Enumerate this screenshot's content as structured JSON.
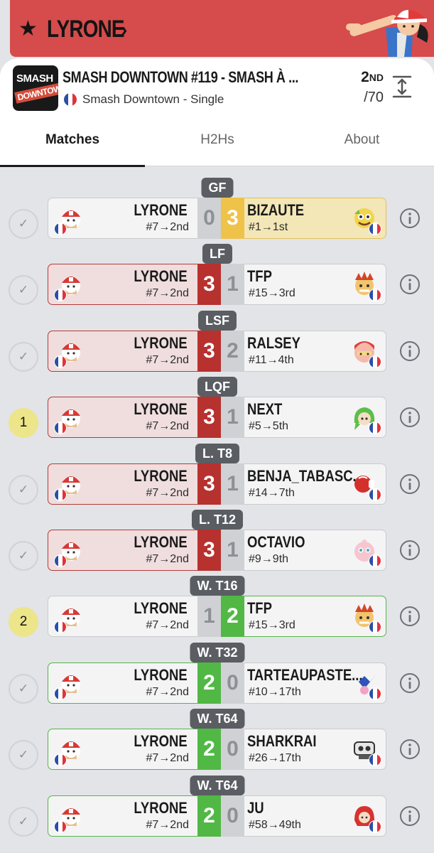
{
  "player": {
    "name": "LYRONE",
    "star_icon": "star-icon",
    "chevron_icon": "chevron-right-icon"
  },
  "tournament": {
    "logo_top": "SMASH",
    "logo_bottom": "DOWNTOWN",
    "title": "SMASH DOWNTOWN #119 - SMASH À ...",
    "subtitle": "Smash Downtown - Single",
    "placement": "2",
    "placement_suffix": "ND",
    "total": "/70"
  },
  "tabs": [
    {
      "label": "Matches",
      "active": true
    },
    {
      "label": "H2Hs",
      "active": false
    },
    {
      "label": "About",
      "active": false
    }
  ],
  "colors": {
    "loss_red": "#b7312f",
    "win_green": "#51b845",
    "gf_gold": "#efc24a",
    "banner_red": "#d64b4b"
  },
  "matches": [
    {
      "round": "GF",
      "check": "✓",
      "left_name": "LYRONE",
      "left_seed": "#7→2nd",
      "left_score": "0",
      "right_score": "3",
      "right_name": "BIZAUTE",
      "right_seed": "#1→1st",
      "result": "gf",
      "opp_icon": "character-icon"
    },
    {
      "round": "LF",
      "check": "✓",
      "left_name": "LYRONE",
      "left_seed": "#7→2nd",
      "left_score": "3",
      "right_score": "1",
      "right_name": "TFP",
      "right_seed": "#15→3rd",
      "result": "lose",
      "opp_icon": "character-icon"
    },
    {
      "round": "LSF",
      "check": "✓",
      "left_name": "LYRONE",
      "left_seed": "#7→2nd",
      "left_score": "3",
      "right_score": "2",
      "right_name": "RALSEY",
      "right_seed": "#11→4th",
      "result": "lose",
      "opp_icon": "character-icon"
    },
    {
      "round": "LQF",
      "check": "1",
      "left_name": "LYRONE",
      "left_seed": "#7→2nd",
      "left_score": "3",
      "right_score": "1",
      "right_name": "NEXT",
      "right_seed": "#5→5th",
      "result": "lose",
      "opp_icon": "character-icon"
    },
    {
      "round": "L. T8",
      "check": "✓",
      "left_name": "LYRONE",
      "left_seed": "#7→2nd",
      "left_score": "3",
      "right_score": "1",
      "right_name": "BENJA_TABASC...",
      "right_seed": "#14→7th",
      "result": "lose",
      "opp_icon": "character-icon"
    },
    {
      "round": "L. T12",
      "check": "✓",
      "left_name": "LYRONE",
      "left_seed": "#7→2nd",
      "left_score": "3",
      "right_score": "1",
      "right_name": "OCTAVIO",
      "right_seed": "#9→9th",
      "result": "lose",
      "opp_icon": "character-icon"
    },
    {
      "round": "W. T16",
      "check": "2",
      "left_name": "LYRONE",
      "left_seed": "#7→2nd",
      "left_score": "1",
      "right_score": "2",
      "right_name": "TFP",
      "right_seed": "#15→3rd",
      "result": "win_r",
      "opp_icon": "character-icon"
    },
    {
      "round": "W. T32",
      "check": "✓",
      "left_name": "LYRONE",
      "left_seed": "#7→2nd",
      "left_score": "2",
      "right_score": "0",
      "right_name": "TARTEAUPASTE...",
      "right_seed": "#10→17th",
      "result": "win",
      "opp_icon": "character-icon"
    },
    {
      "round": "W. T64",
      "check": "✓",
      "left_name": "LYRONE",
      "left_seed": "#7→2nd",
      "left_score": "2",
      "right_score": "0",
      "right_name": "SHARKRAI",
      "right_seed": "#26→17th",
      "result": "win",
      "opp_icon": "character-icon"
    },
    {
      "round": "W. T64",
      "check": "✓",
      "left_name": "LYRONE",
      "left_seed": "#7→2nd",
      "left_score": "2",
      "right_score": "0",
      "right_name": "JU",
      "right_seed": "#58→49th",
      "result": "win",
      "opp_icon": "character-icon"
    }
  ]
}
